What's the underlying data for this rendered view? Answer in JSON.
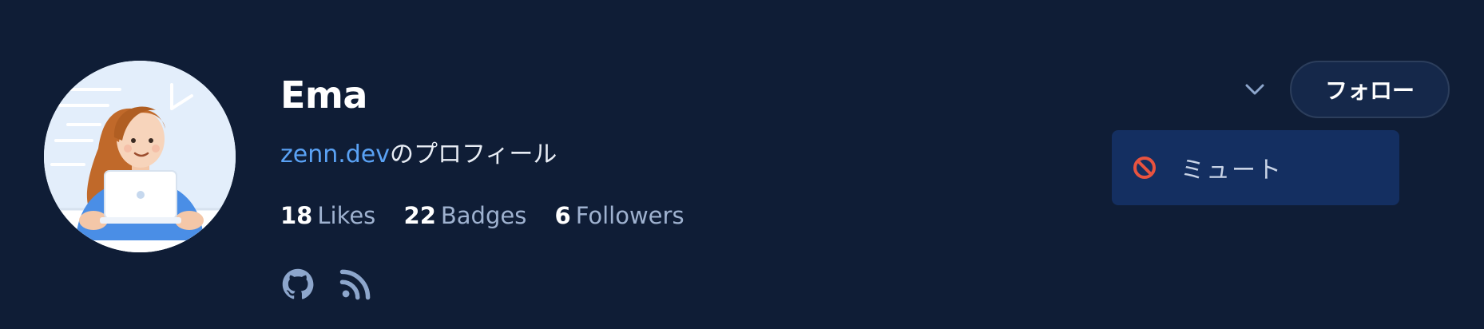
{
  "profile": {
    "name": "Ema",
    "site_link": "zenn.dev",
    "profile_suffix": "のプロフィール",
    "avatar_icon": "avatar-woman-laptop"
  },
  "stats": [
    {
      "value": "18",
      "label": "Likes"
    },
    {
      "value": "22",
      "label": "Badges"
    },
    {
      "value": "6",
      "label": "Followers"
    }
  ],
  "social_links": [
    {
      "icon": "github-icon"
    },
    {
      "icon": "rss-icon"
    }
  ],
  "actions": {
    "follow_label": "フォロー",
    "menu_toggle_icon": "chevron-down-icon"
  },
  "dropdown": {
    "items": [
      {
        "label": "ミュート",
        "icon": "prohibited-icon",
        "icon_color": "#e8533f"
      }
    ]
  },
  "colors": {
    "background": "#0f1d36",
    "link": "#5aa2f5",
    "button_bg": "#15284a",
    "dropdown_bg": "#142f61",
    "muted_text": "#9fb2d0"
  }
}
